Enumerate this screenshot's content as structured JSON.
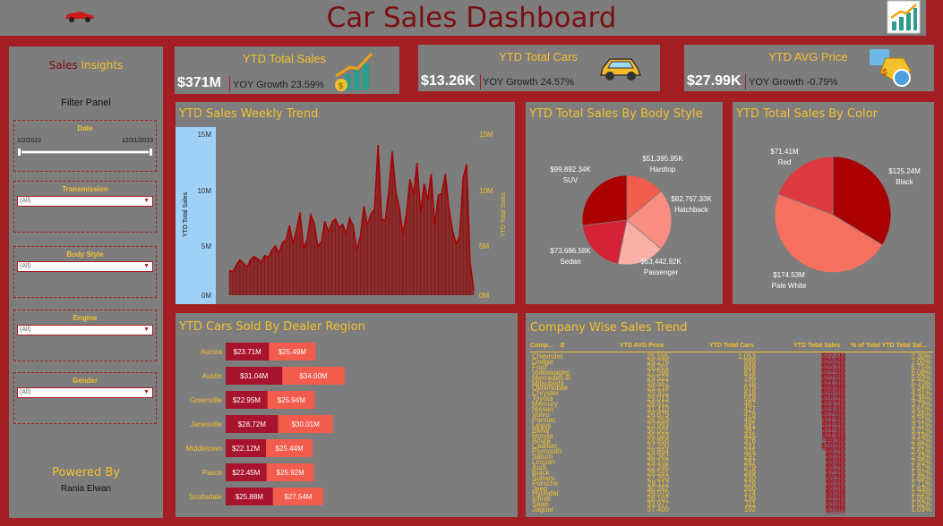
{
  "title": "Car Sales Dashboard",
  "sidebar": {
    "insights_a": "Sales",
    "insights_b": "Insights",
    "filter_panel": "Filter Panel",
    "date_label": "Date",
    "date_from": "1/2/2022",
    "date_to": "12/31/2023",
    "transmission_label": "Transmission",
    "transmission_value": "(All)",
    "body_label": "Body Style",
    "body_value": "(All)",
    "engine_label": "Engine",
    "engine_value": "(All)",
    "gender_label": "Gender",
    "gender_value": "(All)",
    "powered_by": "Powered By",
    "author": "Rania Elwan"
  },
  "kpis": [
    {
      "title": "YTD Total Sales",
      "value": "$371M",
      "yoy": "YOY Growth 23.59%"
    },
    {
      "title": "YTD Total Cars",
      "value": "$13.26K",
      "yoy": "YOY Growth 24.57%"
    },
    {
      "title": "YTD AVG Price",
      "value": "$27.99K",
      "yoy": "YOY Growth -0.79%"
    }
  ],
  "colors": {
    "bg": "#a31f24",
    "panel": "#7d7d7d",
    "accent": "#f2c12e",
    "dark_red": "#a80d12",
    "light_red": "#f25c4c"
  },
  "icons": [
    "car-icon",
    "growth-chart-icon",
    "money-growth-icon",
    "yellow-car-icon",
    "price-tag-icon"
  ],
  "chart_data": [
    {
      "type": "area",
      "title": "YTD Sales Weekly Trend",
      "ylabel": "YTD Total Sales",
      "ylabel_right": "YTD Total Sales",
      "y_ticks": [
        "15M",
        "10M",
        "5M",
        "0M"
      ],
      "ylim": [
        0,
        15
      ],
      "y": [
        2.3,
        2.2,
        2.8,
        3.3,
        3.0,
        2.6,
        3.3,
        3.6,
        3.4,
        3.1,
        3.7,
        3.5,
        4.2,
        4.6,
        3.9,
        4.9,
        5.1,
        6.5,
        4.8,
        6.2,
        7.7,
        4.3,
        5.2,
        7.5,
        6.7,
        4.5,
        5.0,
        6.9,
        5.9,
        6.8,
        7.1,
        6.3,
        6.6,
        5.7,
        7.2,
        6.4,
        4.2,
        5.5,
        8.3,
        6.5,
        7.6,
        8.0,
        14.0,
        7.1,
        6.9,
        9.6,
        13.4,
        9.6,
        8.2,
        5.7,
        7.6,
        10.8,
        9.4,
        12.3,
        7.7,
        10.4,
        8.9,
        11.3,
        6.5,
        9.3,
        9.5,
        11.3,
        8.1,
        6.1,
        4.8,
        5.5,
        10.9,
        12.2,
        3.0,
        0.5
      ]
    },
    {
      "type": "pie",
      "title": "YTD Total Sales By Body Style",
      "labels": [
        "Hardtop",
        "Hatchback",
        "Passenger",
        "Sedan",
        "SUV"
      ],
      "values": [
        51395.95,
        82767.33,
        63442.92,
        73686.58,
        99892.34
      ],
      "value_labels": [
        "$51,395.95K",
        "$82,767.33K",
        "$63,442.92K",
        "$73,686.58K",
        "$99,892.34K"
      ],
      "colors": [
        "#f25c4c",
        "#fa8e82",
        "#fbb0a6",
        "#d42236",
        "#aa0000"
      ]
    },
    {
      "type": "pie",
      "title": "YTD Total Sales By Color",
      "labels": [
        "Black",
        "Pale White",
        "Red"
      ],
      "values": [
        125.24,
        174.53,
        71.41
      ],
      "value_labels": [
        "$125.24M",
        "$174.53M",
        "$71.41M"
      ],
      "colors": [
        "#aa0000",
        "#f5705e",
        "#dc3a40"
      ]
    },
    {
      "type": "bar",
      "title": "YTD Cars Sold By Dealer Region",
      "categories": [
        "Aurora",
        "Austin",
        "Greenville",
        "Janesville",
        "Middletown",
        "Pasco",
        "Scottsdale"
      ],
      "series": [
        {
          "values": [
            23.71,
            31.04,
            22.95,
            28.72,
            22.12,
            22.45,
            25.88
          ],
          "labels": [
            "$23.71M",
            "$31.04M",
            "$22.95M",
            "$28.72M",
            "$22.12M",
            "$22.45M",
            "$25.88M"
          ]
        },
        {
          "values": [
            25.49,
            34.0,
            25.94,
            30.01,
            25.44,
            25.92,
            27.54
          ],
          "labels": [
            "$25.49M",
            "$34.00M",
            "$25.94M",
            "$30.01M",
            "$25.44M",
            "$25.92M",
            "$27.54M"
          ]
        }
      ]
    },
    {
      "type": "table",
      "title": "Company Wise Sales Trend",
      "columns": [
        "Comp...",
        "YTD AVG Price",
        "YTD Total Cars",
        "YTD Total Sales",
        "% of Total YTD Total Sal..."
      ],
      "rows": [
        [
          "Chevrolet",
          "25,595",
          "1,053",
          "$27.1M",
          "7.30%"
        ],
        [
          "Dodge",
          "26,276",
          "989",
          "$26.0M",
          "7.00%"
        ],
        [
          "Ford",
          "28,201",
          "888",
          "$25.1M",
          "6.75%"
        ],
        [
          "Volkswagen",
          "27,596",
          "818",
          "$22.6M",
          "6.08%"
        ],
        [
          "Mercedes-B",
          "29,522",
          "746",
          "$22.0M",
          "5.93%"
        ],
        [
          "Mitsubishi",
          "29,557",
          "716",
          "$21.2M",
          "5.70%"
        ],
        [
          "Oldsmobile",
          "29,218",
          "679",
          "$19.8M",
          "5.34%"
        ],
        [
          "Chrysler",
          "25,911",
          "618",
          "$16.0M",
          "4.31%"
        ],
        [
          "Toyota",
          "29,013",
          "558",
          "$16.2M",
          "4.36%"
        ],
        [
          "Mercury",
          "28,912",
          "487",
          "$14.1M",
          "3.79%"
        ],
        [
          "Nissan",
          "31,410",
          "427",
          "$13.4M",
          "3.61%"
        ],
        [
          "Volvo",
          "26,879",
          "478",
          "$12.8M",
          "3.46%"
        ],
        [
          "Pontiac",
          "24,263",
          "492",
          "$11.9M",
          "3.21%"
        ],
        [
          "Lexus",
          "23,993",
          "481",
          "$11.5M",
          "3.11%"
        ],
        [
          "BMW",
          "30,001",
          "397",
          "$11.9M",
          "3.21%"
        ],
        [
          "Honda",
          "26,593",
          "445",
          "$11.8M",
          "3.19%"
        ],
        [
          "Acura",
          "24,856",
          "376",
          "$9.3M",
          "2.52%"
        ],
        [
          "Cadillac",
          "37,200",
          "291",
          "$10.8M",
          "2.92%"
        ],
        [
          "Plymouth",
          "29,854",
          "325",
          "$9.7M",
          "2.61%"
        ],
        [
          "Saturn",
          "30,362",
          "297",
          "$9.0M",
          "2.43%"
        ],
        [
          "Lincoln",
          "29,102",
          "287",
          "$8.4M",
          "2.25%"
        ],
        [
          "Audi",
          "22,245",
          "279",
          "$6.2M",
          "1.67%"
        ],
        [
          "Buick",
          "28,591",
          "249",
          "$7.1M",
          "1.92%"
        ],
        [
          "Subaru",
          "27,250",
          "230",
          "$6.3M",
          "1.69%"
        ],
        [
          "Porsche",
          "28,112",
          "226",
          "$6.4M",
          "1.71%"
        ],
        [
          "Jeep",
          "30,267",
          "200",
          "$6.1M",
          "1.63%"
        ],
        [
          "Hyundai",
          "26,070",
          "174",
          "$4.5M",
          "1.22%"
        ],
        [
          "Infiniti",
          "28,107",
          "139",
          "$3.9M",
          "1.05%"
        ],
        [
          "Saab",
          "33,977",
          "111",
          "$3.8M",
          "1.02%"
        ],
        [
          "Jaguar",
          "37,400",
          "102",
          "$3.8M",
          "1.03%"
        ]
      ]
    }
  ]
}
